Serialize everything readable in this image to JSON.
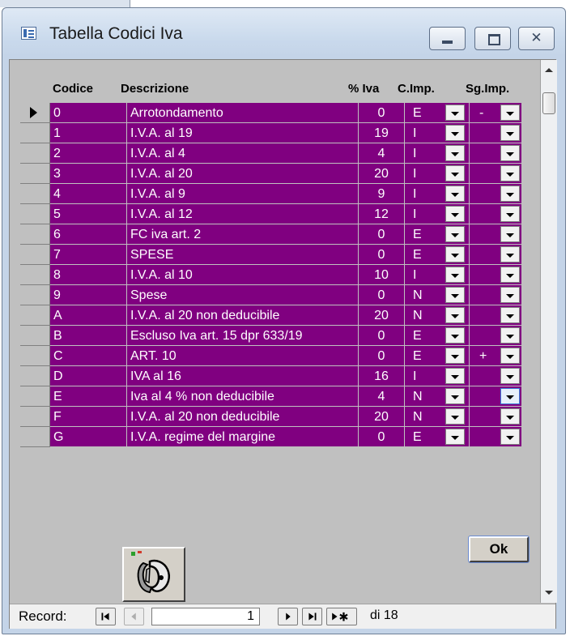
{
  "window": {
    "title": "Tabella Codici Iva",
    "close_label": "✕"
  },
  "columns": {
    "codice": "Codice",
    "descrizione": "Descrizione",
    "iva": "% Iva",
    "cimp": "C.Imp.",
    "sgimp": "Sg.Imp."
  },
  "rows": [
    {
      "codice": "0",
      "descrizione": "Arrotondamento",
      "iva": "0",
      "cimp": "E",
      "sgimp": "-"
    },
    {
      "codice": "1",
      "descrizione": "I.V.A. al 19",
      "iva": "19",
      "cimp": "I",
      "sgimp": ""
    },
    {
      "codice": "2",
      "descrizione": "I.V.A. al 4",
      "iva": "4",
      "cimp": "I",
      "sgimp": ""
    },
    {
      "codice": "3",
      "descrizione": "I.V.A. al 20",
      "iva": "20",
      "cimp": "I",
      "sgimp": ""
    },
    {
      "codice": "4",
      "descrizione": "I.V.A. al 9",
      "iva": "9",
      "cimp": "I",
      "sgimp": ""
    },
    {
      "codice": "5",
      "descrizione": "I.V.A. al 12",
      "iva": "12",
      "cimp": "I",
      "sgimp": ""
    },
    {
      "codice": "6",
      "descrizione": "FC iva art. 2",
      "iva": "0",
      "cimp": "E",
      "sgimp": ""
    },
    {
      "codice": "7",
      "descrizione": "SPESE",
      "iva": "0",
      "cimp": "E",
      "sgimp": ""
    },
    {
      "codice": "8",
      "descrizione": "I.V.A. al 10",
      "iva": "10",
      "cimp": "I",
      "sgimp": ""
    },
    {
      "codice": "9",
      "descrizione": "Spese",
      "iva": "0",
      "cimp": "N",
      "sgimp": ""
    },
    {
      "codice": "A",
      "descrizione": "I.V.A. al 20  non deducibile",
      "iva": "20",
      "cimp": "N",
      "sgimp": ""
    },
    {
      "codice": "B",
      "descrizione": "Escluso Iva art. 15 dpr 633/19",
      "iva": "0",
      "cimp": "E",
      "sgimp": ""
    },
    {
      "codice": "C",
      "descrizione": "ART. 10",
      "iva": "0",
      "cimp": "E",
      "sgimp": "+"
    },
    {
      "codice": "D",
      "descrizione": "IVA al 16",
      "iva": "16",
      "cimp": "I",
      "sgimp": ""
    },
    {
      "codice": "E",
      "descrizione": "Iva al 4 % non deducibile",
      "iva": "4",
      "cimp": "N",
      "sgimp": ""
    },
    {
      "codice": "F",
      "descrizione": "I.V.A. al 20 non deducibile",
      "iva": "20",
      "cimp": "N",
      "sgimp": ""
    },
    {
      "codice": "G",
      "descrizione": "I.V.A. regime del margine",
      "iva": "0",
      "cimp": "E",
      "sgimp": ""
    }
  ],
  "current_row_index": 0,
  "focused_dropdown_row": 14,
  "buttons": {
    "ok": "Ok"
  },
  "recordbar": {
    "label": "Record:",
    "current": "1",
    "total": "di 18"
  },
  "colors": {
    "row_bg": "#800080",
    "form_bg": "#c0c0c0"
  }
}
